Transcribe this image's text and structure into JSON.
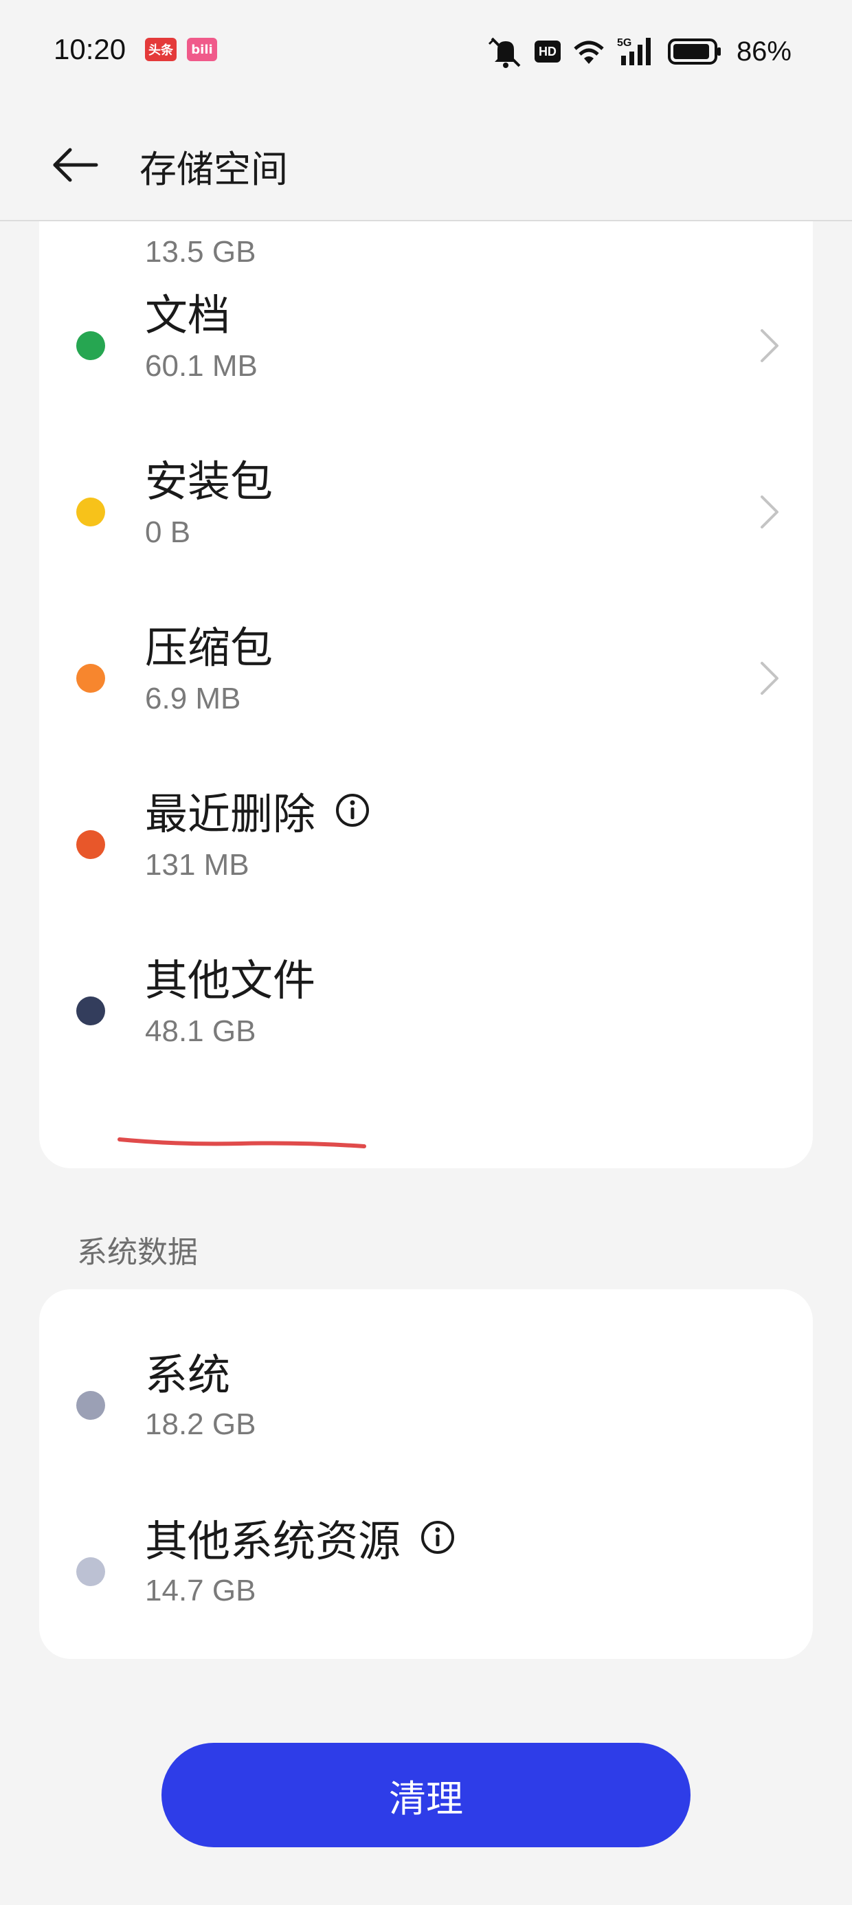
{
  "status_bar": {
    "time": "10:20",
    "app_badges": [
      "头条",
      "bili"
    ],
    "battery": "86%",
    "hd": "HD",
    "network": "5G"
  },
  "header": {
    "title": "存储空间",
    "back_icon": "arrow-left-icon"
  },
  "media_files": [
    {
      "title": "",
      "size": "13.5 GB",
      "color": "#1a73e8",
      "chevron": true,
      "info": false
    },
    {
      "title": "文档",
      "size": "60.1 MB",
      "color": "#26a651",
      "chevron": true,
      "info": false
    },
    {
      "title": "安装包",
      "size": "0 B",
      "color": "#f7c21a",
      "chevron": true,
      "info": false
    },
    {
      "title": "压缩包",
      "size": "6.9 MB",
      "color": "#f7862e",
      "chevron": true,
      "info": false
    },
    {
      "title": "最近删除",
      "size": "131 MB",
      "color": "#e8572a",
      "chevron": false,
      "info": true
    },
    {
      "title": "其他文件",
      "size": "48.1 GB",
      "color": "#333d5c",
      "chevron": false,
      "info": false
    }
  ],
  "system_section": {
    "title": "系统数据",
    "items": [
      {
        "title": "系统",
        "size": "18.2 GB",
        "color": "#9ba0b5",
        "info": false
      },
      {
        "title": "其他系统资源",
        "size": "14.7 GB",
        "color": "#bcc1d3",
        "info": true
      }
    ]
  },
  "clean_button": {
    "label": "清理",
    "color": "#2e3de8"
  },
  "annotation_color": "#e04b4b"
}
